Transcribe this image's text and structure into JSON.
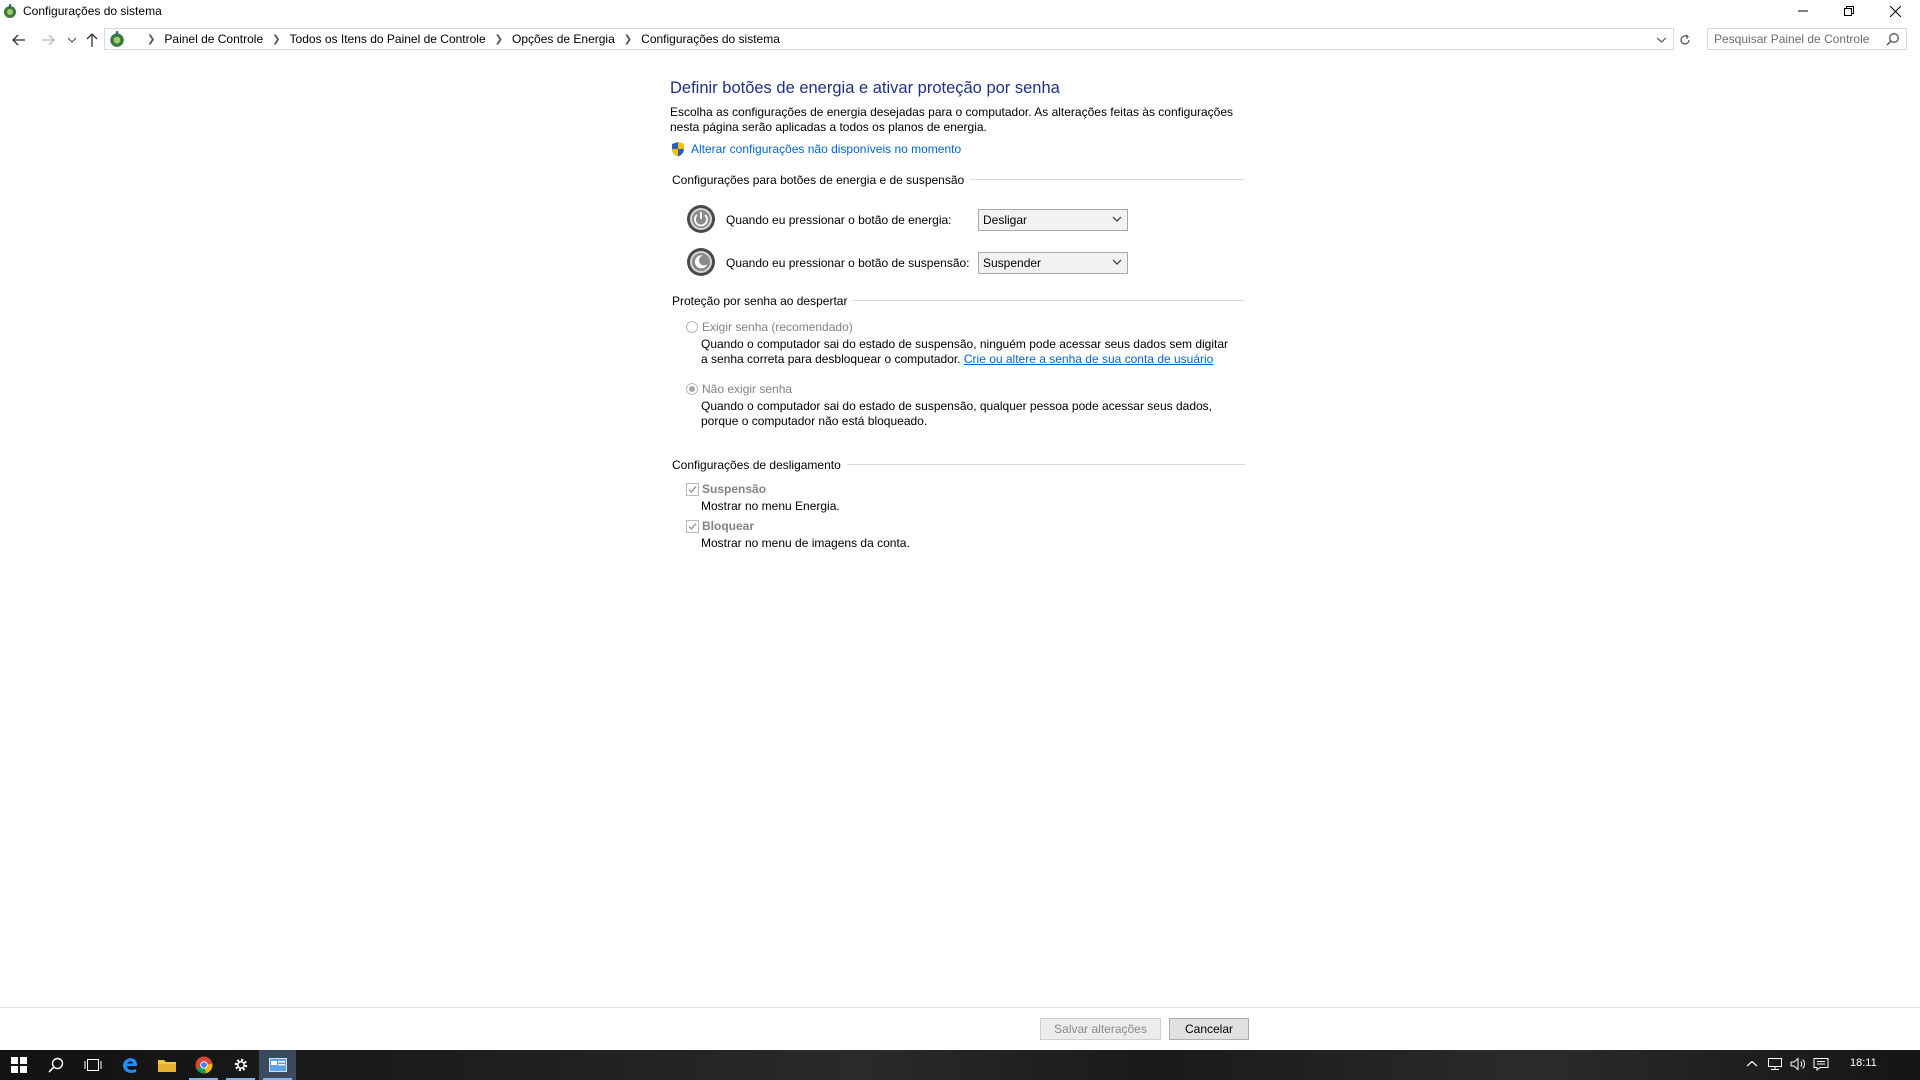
{
  "window": {
    "title": "Configurações do sistema",
    "minimize_icon": "minimize-icon",
    "maximize_icon": "restore-icon",
    "close_icon": "close-icon"
  },
  "address": {
    "crumbs": [
      "Painel de Controle",
      "Todos os Itens do Painel de Controle",
      "Opções de Energia",
      "Configurações do sistema"
    ],
    "search_placeholder": "Pesquisar Painel de Controle"
  },
  "main": {
    "title": "Definir botões de energia e ativar proteção por senha",
    "description": "Escolha as configurações de energia desejadas para o computador. As alterações feitas às configurações nesta página serão aplicadas a todos os planos de energia.",
    "change_link": "Alterar configurações não disponíveis no momento",
    "power_section": {
      "title": "Configurações para botões de energia e de suspensão",
      "power_button_label": "Quando eu pressionar o botão de energia:",
      "power_button_value": "Desligar",
      "sleep_button_label": "Quando eu pressionar o botão de suspensão:",
      "sleep_button_value": "Suspender"
    },
    "password_section": {
      "title": "Proteção por senha ao despertar",
      "require_label": "Exigir senha (recomendado)",
      "require_selected": false,
      "require_desc_1": "Quando o computador sai do estado de suspensão, ninguém pode acessar seus dados sem digitar",
      "require_desc_2": "a senha correta para desbloquear o computador.",
      "require_link": "Crie ou altere a senha de sua conta de usuário",
      "no_require_label": "Não exigir senha",
      "no_require_selected": true,
      "no_require_desc_1": "Quando o computador sai do estado de suspensão, qualquer pessoa pode acessar seus dados,",
      "no_require_desc_2": "porque o computador não está bloqueado."
    },
    "shutdown_section": {
      "title": "Configurações de desligamento",
      "sleep_label": "Suspensão",
      "sleep_checked": true,
      "sleep_desc": "Mostrar no menu Energia.",
      "lock_label": "Bloquear",
      "lock_checked": true,
      "lock_desc": "Mostrar no menu de imagens da conta."
    }
  },
  "footer": {
    "save_label": "Salvar alterações",
    "cancel_label": "Cancelar"
  },
  "taskbar": {
    "clock": "18:11"
  }
}
